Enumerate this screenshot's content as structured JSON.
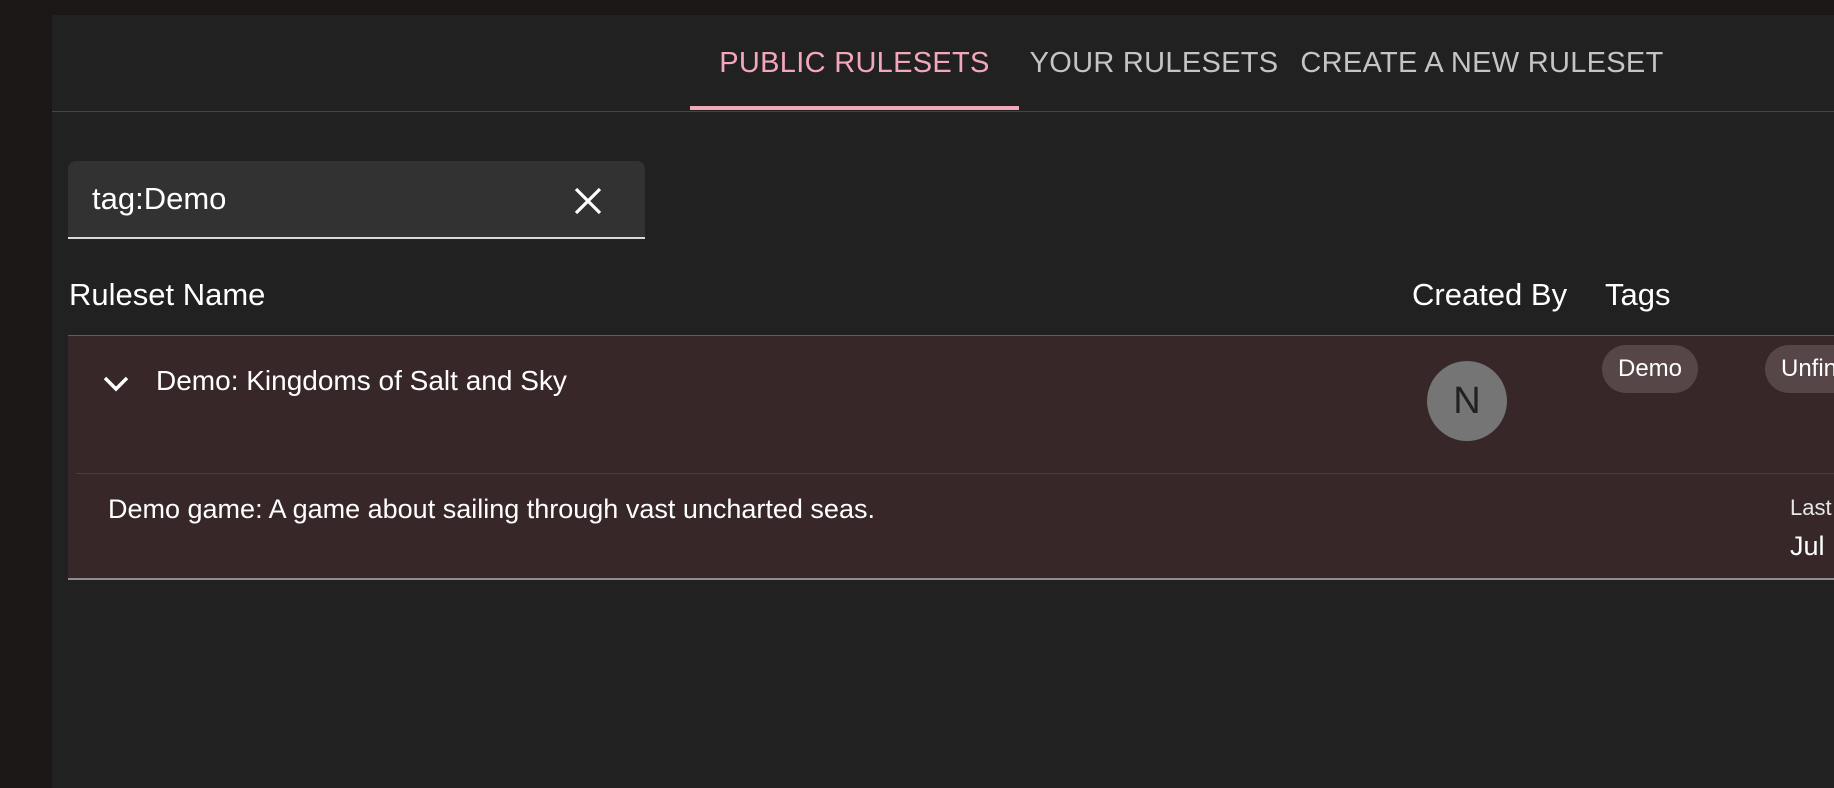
{
  "tabs": [
    {
      "label": "PUBLIC RULESETS",
      "active": true
    },
    {
      "label": "YOUR RULESETS",
      "active": false
    },
    {
      "label": "CREATE A NEW RULESET",
      "active": false
    }
  ],
  "search": {
    "value": "tag:Demo",
    "clear_icon": "close-icon"
  },
  "table": {
    "columns": [
      "Ruleset Name",
      "Created By",
      "Tags"
    ],
    "rows": [
      {
        "name": "Demo: Kingdoms of Salt and Sky",
        "expand_icon": "chevron-down-icon",
        "avatar_initial": "N",
        "tags": [
          "Demo",
          "Unfinished"
        ],
        "description": "Demo game: A game about sailing through vast uncharted seas.",
        "updated_label": "Last updated",
        "updated_value": "Jul"
      }
    ]
  },
  "colors": {
    "accent": "#f4a6bb",
    "background": "#212121",
    "row_background": "#372729",
    "chip_background": "#564648",
    "avatar_background": "#757575"
  }
}
